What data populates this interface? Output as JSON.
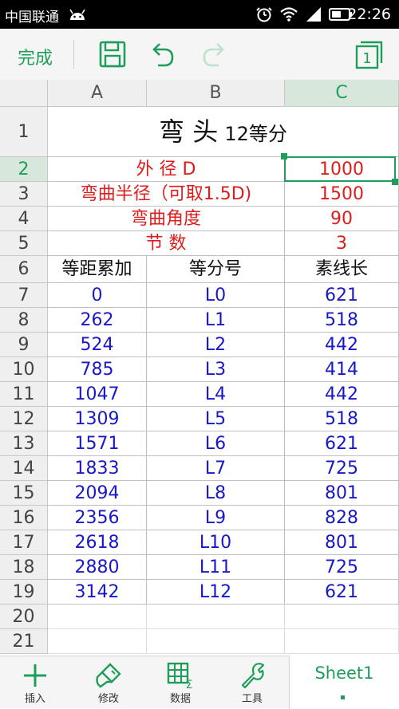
{
  "status_bar": {
    "carrier": "中国联通",
    "time": "22:26"
  },
  "toolbar": {
    "done_label": "完成"
  },
  "columns": [
    "A",
    "B",
    "C"
  ],
  "rows": [
    "1",
    "2",
    "3",
    "4",
    "5",
    "6",
    "7",
    "8",
    "9",
    "10",
    "11",
    "12",
    "13",
    "14",
    "15",
    "16",
    "17",
    "18",
    "19",
    "20",
    "21"
  ],
  "sheet": {
    "title_main": "弯 头",
    "title_sub": "12等分",
    "params": [
      {
        "label": "外 径 D",
        "value": "1000"
      },
      {
        "label": "弯曲半径（可取1.5D)",
        "value": "1500"
      },
      {
        "label": "弯曲角度",
        "value": "90"
      },
      {
        "label": "节 数",
        "value": "3"
      }
    ],
    "headers": [
      "等距累加",
      "等分号",
      "素线长"
    ],
    "data": [
      [
        "0",
        "L0",
        "621"
      ],
      [
        "262",
        "L1",
        "518"
      ],
      [
        "524",
        "L2",
        "442"
      ],
      [
        "785",
        "L3",
        "414"
      ],
      [
        "1047",
        "L4",
        "442"
      ],
      [
        "1309",
        "L5",
        "518"
      ],
      [
        "1571",
        "L6",
        "621"
      ],
      [
        "1833",
        "L7",
        "725"
      ],
      [
        "2094",
        "L8",
        "801"
      ],
      [
        "2356",
        "L9",
        "828"
      ],
      [
        "2618",
        "L10",
        "801"
      ],
      [
        "2880",
        "L11",
        "725"
      ],
      [
        "3142",
        "L12",
        "621"
      ]
    ]
  },
  "bottom_bar": {
    "insert_label": "插入",
    "edit_label": "修改",
    "data_label": "数据",
    "tools_label": "工具",
    "sheet_tab": "Sheet1"
  },
  "colors": {
    "accent": "#1e9e5a",
    "red_text": "#dd1c1c",
    "blue_text": "#1818c8"
  },
  "icons": [
    "robot-icon",
    "alarm-icon",
    "wifi-icon",
    "signal-icon",
    "battery-icon",
    "save-icon",
    "undo-icon",
    "redo-icon",
    "page-count-icon",
    "plus-icon",
    "brush-icon",
    "table-sigma-icon",
    "wrench-icon"
  ]
}
